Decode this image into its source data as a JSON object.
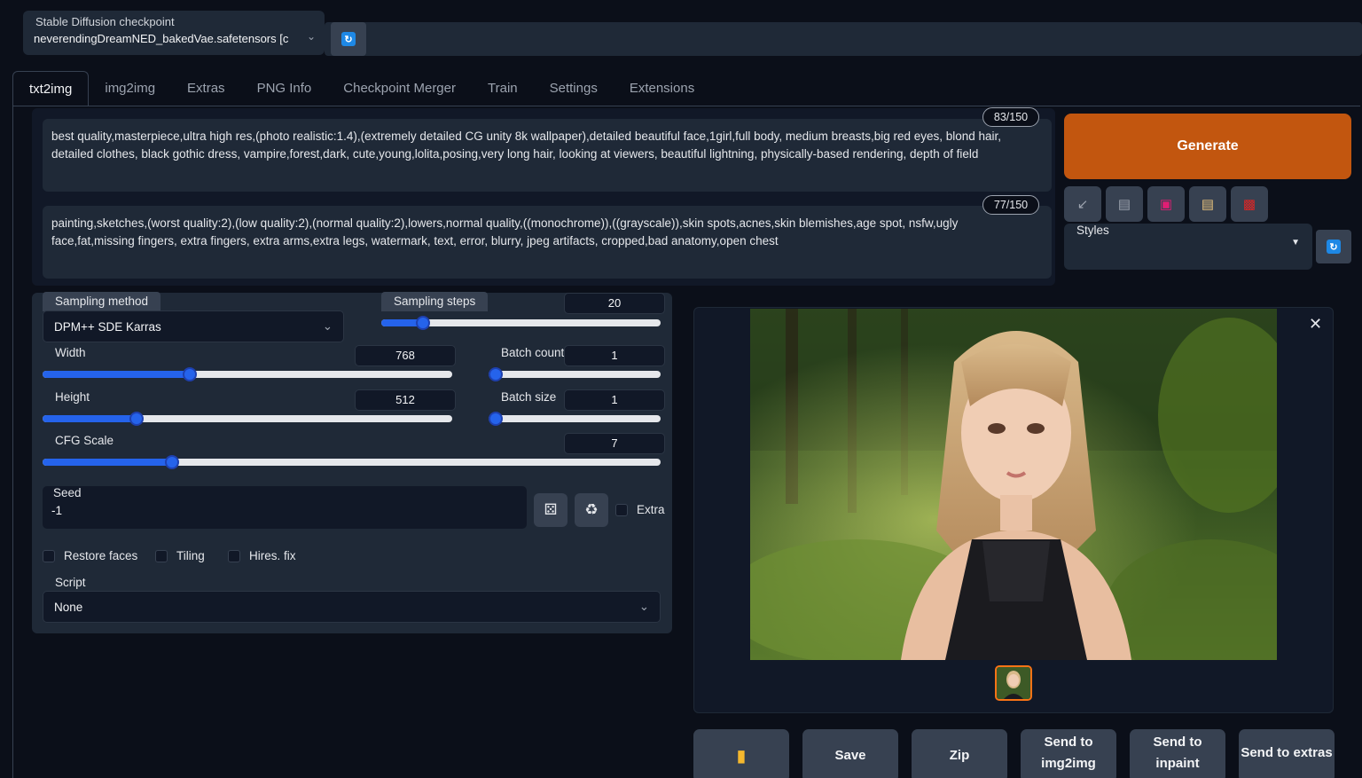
{
  "checkpoint": {
    "label": "Stable Diffusion checkpoint",
    "value": "neverendingDreamNED_bakedVae.safetensors [c"
  },
  "tabs": [
    {
      "label": "txt2img",
      "active": true
    },
    {
      "label": "img2img"
    },
    {
      "label": "Extras"
    },
    {
      "label": "PNG Info"
    },
    {
      "label": "Checkpoint Merger"
    },
    {
      "label": "Train"
    },
    {
      "label": "Settings"
    },
    {
      "label": "Extensions"
    }
  ],
  "prompt": {
    "text": "best quality,masterpiece,ultra high res,(photo realistic:1.4),(extremely detailed CG unity 8k wallpaper),detailed beautiful face,1girl,full body, medium breasts,big red eyes, blond hair, detailed clothes, black gothic dress, vampire,forest,dark, cute,young,lolita,posing,very long hair, looking at viewers, beautiful lightning, physically-based rendering, depth of field",
    "counter": "83/150"
  },
  "negative_prompt": {
    "text": "painting,sketches,(worst quality:2),(low quality:2),(normal quality:2),lowers,normal quality,((monochrome)),((grayscale)),skin spots,acnes,skin blemishes,age spot, nsfw,ugly face,fat,missing fingers, extra fingers, extra arms,extra legs, watermark, text, error, blurry, jpeg artifacts, cropped,bad anatomy,open chest",
    "counter": "77/150"
  },
  "generate_label": "Generate",
  "styles_label": "Styles",
  "sampling": {
    "method_label": "Sampling method",
    "method_value": "DPM++ SDE Karras",
    "steps_label": "Sampling steps",
    "steps_value": "20"
  },
  "width": {
    "label": "Width",
    "value": "768"
  },
  "height": {
    "label": "Height",
    "value": "512"
  },
  "batch_count": {
    "label": "Batch count",
    "value": "1"
  },
  "batch_size": {
    "label": "Batch size",
    "value": "1"
  },
  "cfg": {
    "label": "CFG Scale",
    "value": "7"
  },
  "seed": {
    "label": "Seed",
    "value": "-1",
    "extra_label": "Extra"
  },
  "checkboxes": {
    "restore_faces": "Restore faces",
    "tiling": "Tiling",
    "hires_fix": "Hires. fix"
  },
  "script": {
    "label": "Script",
    "value": "None"
  },
  "actions": {
    "save": "Save",
    "zip": "Zip",
    "send_img2img": "Send to img2img",
    "send_inpaint": "Send to inpaint",
    "send_extras": "Send to extras"
  },
  "colors": {
    "accent": "#c2560f",
    "slider": "#2563eb",
    "background": "#0b0f19"
  }
}
